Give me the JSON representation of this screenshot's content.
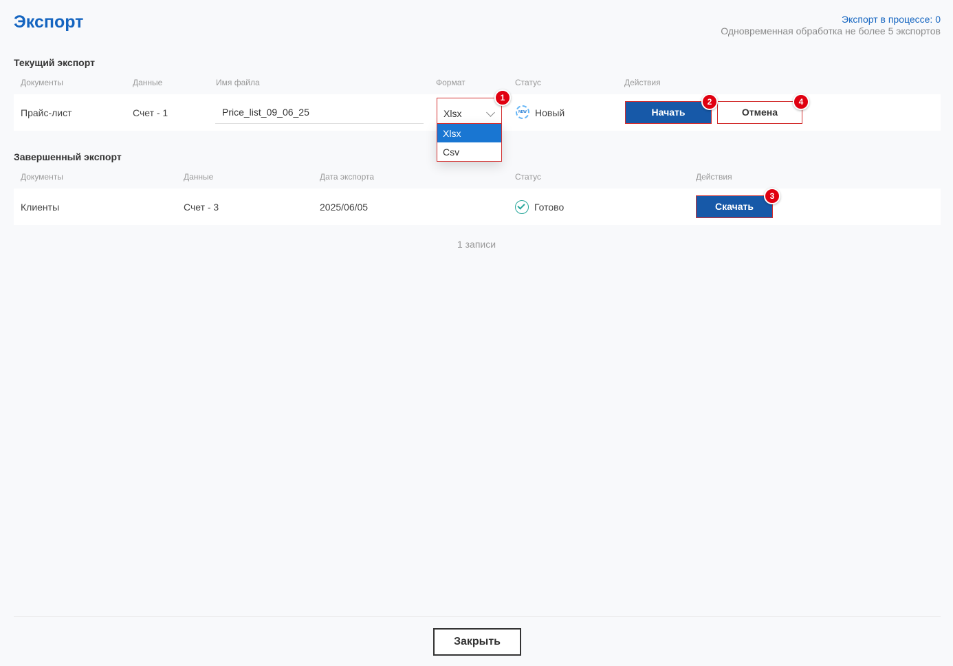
{
  "header": {
    "title": "Экспорт",
    "in_process": "Экспорт в процессе: 0",
    "limit_note": "Одновременная обработка не более 5 экспортов"
  },
  "current": {
    "section_title": "Текущий экспорт",
    "columns": [
      "Документы",
      "Данные",
      "Имя файла",
      "Формат",
      "Статус",
      "Действия"
    ],
    "row": {
      "document": "Прайс-лист",
      "data": "Счет - 1",
      "filename": "Price_list_09_06_25",
      "format": "Xlsx",
      "status_icon_text": "NEW",
      "status": "Новый",
      "start_label": "Начать",
      "cancel_label": "Отмена"
    },
    "format_options": [
      "Xlsx",
      "Csv"
    ]
  },
  "completed": {
    "section_title": "Завершенный экспорт",
    "columns": [
      "Документы",
      "Данные",
      "Дата экспорта",
      "Статус",
      "Действия"
    ],
    "row": {
      "document": "Клиенты",
      "data": "Счет - 3",
      "date": "2025/06/05",
      "status": "Готово",
      "download_label": "Скачать"
    }
  },
  "records_count": "1 записи",
  "badges": [
    "1",
    "2",
    "3",
    "4"
  ],
  "footer": {
    "close_label": "Закрыть"
  },
  "colors": {
    "accent": "#1565c0",
    "primary_button": "#1759a8",
    "highlight": "#d32f2f",
    "ok": "#26a69a"
  }
}
